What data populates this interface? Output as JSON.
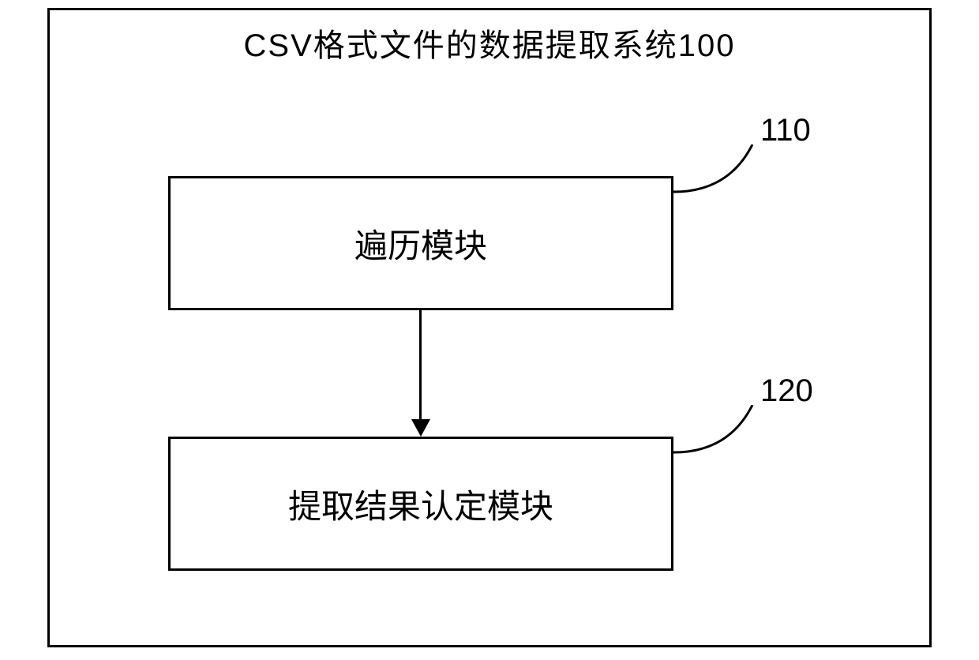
{
  "diagram": {
    "title": "CSV格式文件的数据提取系统100",
    "boxes": [
      {
        "label": "遍历模块",
        "ref": "110"
      },
      {
        "label": "提取结果认定模块",
        "ref": "120"
      }
    ]
  }
}
